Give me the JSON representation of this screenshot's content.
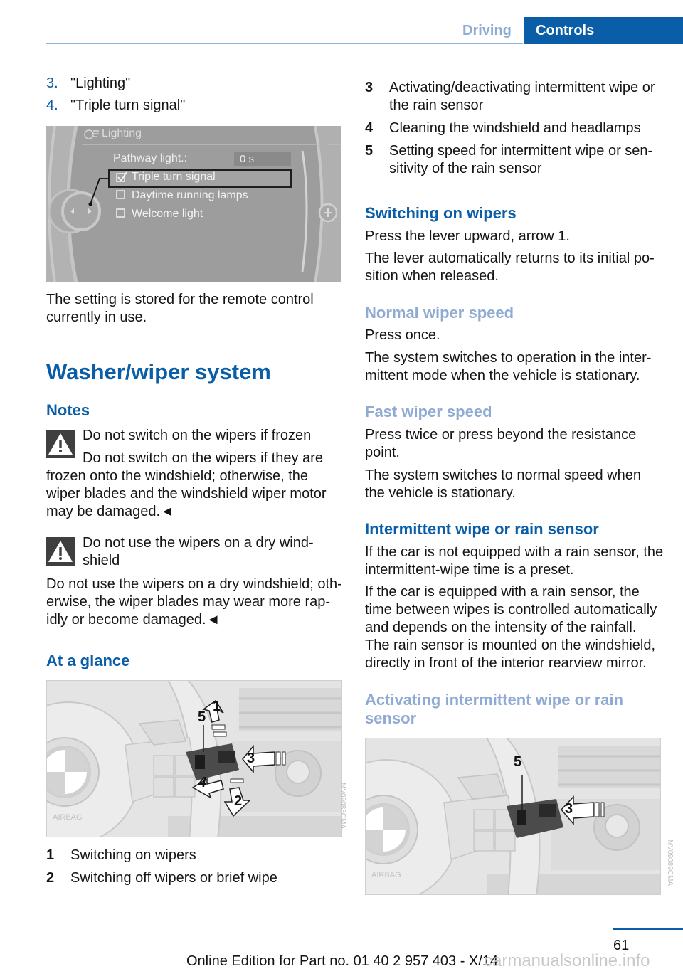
{
  "header": {
    "section": "Driving",
    "chapter": "Controls"
  },
  "left": {
    "steps": [
      {
        "num": "3.",
        "text": "\"Lighting\""
      },
      {
        "num": "4.",
        "text": "\"Triple turn signal\""
      }
    ],
    "lighting_screen": {
      "title": "Lighting",
      "pathway_label": "Pathway light.:",
      "pathway_value": "0 s",
      "options": [
        {
          "label": "Triple turn signal",
          "checked": true
        },
        {
          "label": "Daytime running lamps",
          "checked": false
        },
        {
          "label": "Welcome light",
          "checked": false
        }
      ]
    },
    "stored_note": [
      "The setting is stored for the remote control",
      "currently in use."
    ],
    "section_title": "Washer/wiper system",
    "notes_title": "Notes",
    "warning1": {
      "title": "Do not switch on the wipers if frozen",
      "lines": [
        "Do not switch on the wipers if they are",
        "frozen onto the windshield; otherwise, the",
        "wiper blades and the windshield wiper motor",
        "may be damaged.◄"
      ]
    },
    "warning2": {
      "title_lines": [
        "Do not use the wipers on a dry wind-",
        "shield"
      ],
      "lines": [
        "Do not use the wipers on a dry windshield; oth-",
        "erwise, the wiper blades may wear more rap-",
        "idly or become damaged.◄"
      ]
    },
    "glance_title": "At a glance",
    "figure1": {
      "callouts": [
        "1",
        "2",
        "3",
        "4",
        "5"
      ],
      "airbag_label": "AIRBAG",
      "code": "MV09088CMA"
    },
    "legend": [
      {
        "num": "1",
        "text": "Switching on wipers"
      },
      {
        "num": "2",
        "text": "Switching off wipers or brief wipe"
      }
    ]
  },
  "right": {
    "legend": [
      {
        "num": "3",
        "lines": [
          "Activating/deactivating intermittent wipe or",
          "the rain sensor"
        ]
      },
      {
        "num": "4",
        "lines": [
          "Cleaning the windshield and headlamps"
        ]
      },
      {
        "num": "5",
        "lines": [
          "Setting speed for intermittent wipe or sen-",
          "sitivity of the rain sensor"
        ]
      }
    ],
    "switching_on": {
      "title": "Switching on wipers",
      "p1": "Press the lever upward, arrow 1.",
      "p2": [
        "The lever automatically returns to its initial po-",
        "sition when released."
      ]
    },
    "normal_speed": {
      "title": "Normal wiper speed",
      "p1": "Press once.",
      "p2": [
        "The system switches to operation in the inter-",
        "mittent mode when the vehicle is stationary."
      ]
    },
    "fast_speed": {
      "title": "Fast wiper speed",
      "p1": [
        "Press twice or press beyond the resistance",
        "point."
      ],
      "p2": [
        "The system switches to normal speed when",
        "the vehicle is stationary."
      ]
    },
    "intermittent": {
      "title": "Intermittent wipe or rain sensor",
      "p1": [
        "If the car is not equipped with a rain sensor, the",
        "intermittent-wipe time is a preset."
      ],
      "p2": [
        "If the car is equipped with a rain sensor, the",
        "time between wipes is controlled automatically",
        "and depends on the intensity of the rainfall.",
        "The rain sensor is mounted on the windshield,",
        "directly in front of the interior rearview mirror."
      ]
    },
    "activating": {
      "title_lines": [
        "Activating intermittent wipe or rain",
        "sensor"
      ]
    },
    "figure2": {
      "callouts": [
        "5",
        "3"
      ],
      "airbag_label": "AIRBAG",
      "code": "MV09089CMA"
    }
  },
  "footer": {
    "page": "61",
    "edition": "Online Edition for Part no. 01 40 2 957 403 - X/14",
    "watermark": "carmanualsonline.info"
  }
}
